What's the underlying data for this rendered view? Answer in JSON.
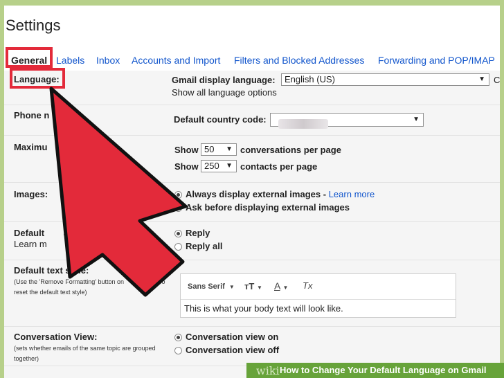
{
  "title": "Settings",
  "tabs": [
    "General",
    "Labels",
    "Inbox",
    "Accounts and Import",
    "Filters and Blocked Addresses",
    "Forwarding and POP/IMAP"
  ],
  "language": {
    "label": "Language:",
    "display_label": "Gmail display language:",
    "value": "English (US)",
    "show_all": "Show all language options",
    "extra": "C"
  },
  "phone": {
    "label": "Phone n",
    "country_label": "Default country code:",
    "arrow": "▼"
  },
  "max_page": {
    "label": "Maximu",
    "show1": "Show",
    "conv_value": "50",
    "conv_text": "conversations per page",
    "show2": "Show",
    "contacts_value": "250",
    "contacts_text": "contacts per page"
  },
  "images": {
    "label": "Images:",
    "opt1": "Always display external images",
    "dash": "-",
    "learn_more": "Learn more",
    "opt2": "Ask before displaying external images"
  },
  "reply": {
    "label": "Default",
    "label_tail": "av",
    "learn": "Learn m",
    "opt1": "Reply",
    "opt2": "Reply all"
  },
  "text_style": {
    "label": "Default text style:",
    "desc": "(Use the 'Remove Formatting' button on",
    "desc_tail": "o",
    "desc2": "reset the default text style)",
    "font": "Sans Serif",
    "size_glyph": "тT",
    "color_glyph": "A",
    "clear_glyph": "Tx",
    "sample": "This is what your body text will look like."
  },
  "conversation": {
    "label": "Conversation View:",
    "desc": "(sets whether emails of the same topic are grouped together)",
    "opt1": "Conversation view on",
    "opt2": "Conversation view off"
  },
  "footer": {
    "wiki": "wiki",
    "caption": "How to Change Your Default Language on Gmail"
  },
  "colors": {
    "highlight": "#e32a3a",
    "link": "#1155cc",
    "frame": "#b7d08a",
    "footer": "#67a33a"
  }
}
